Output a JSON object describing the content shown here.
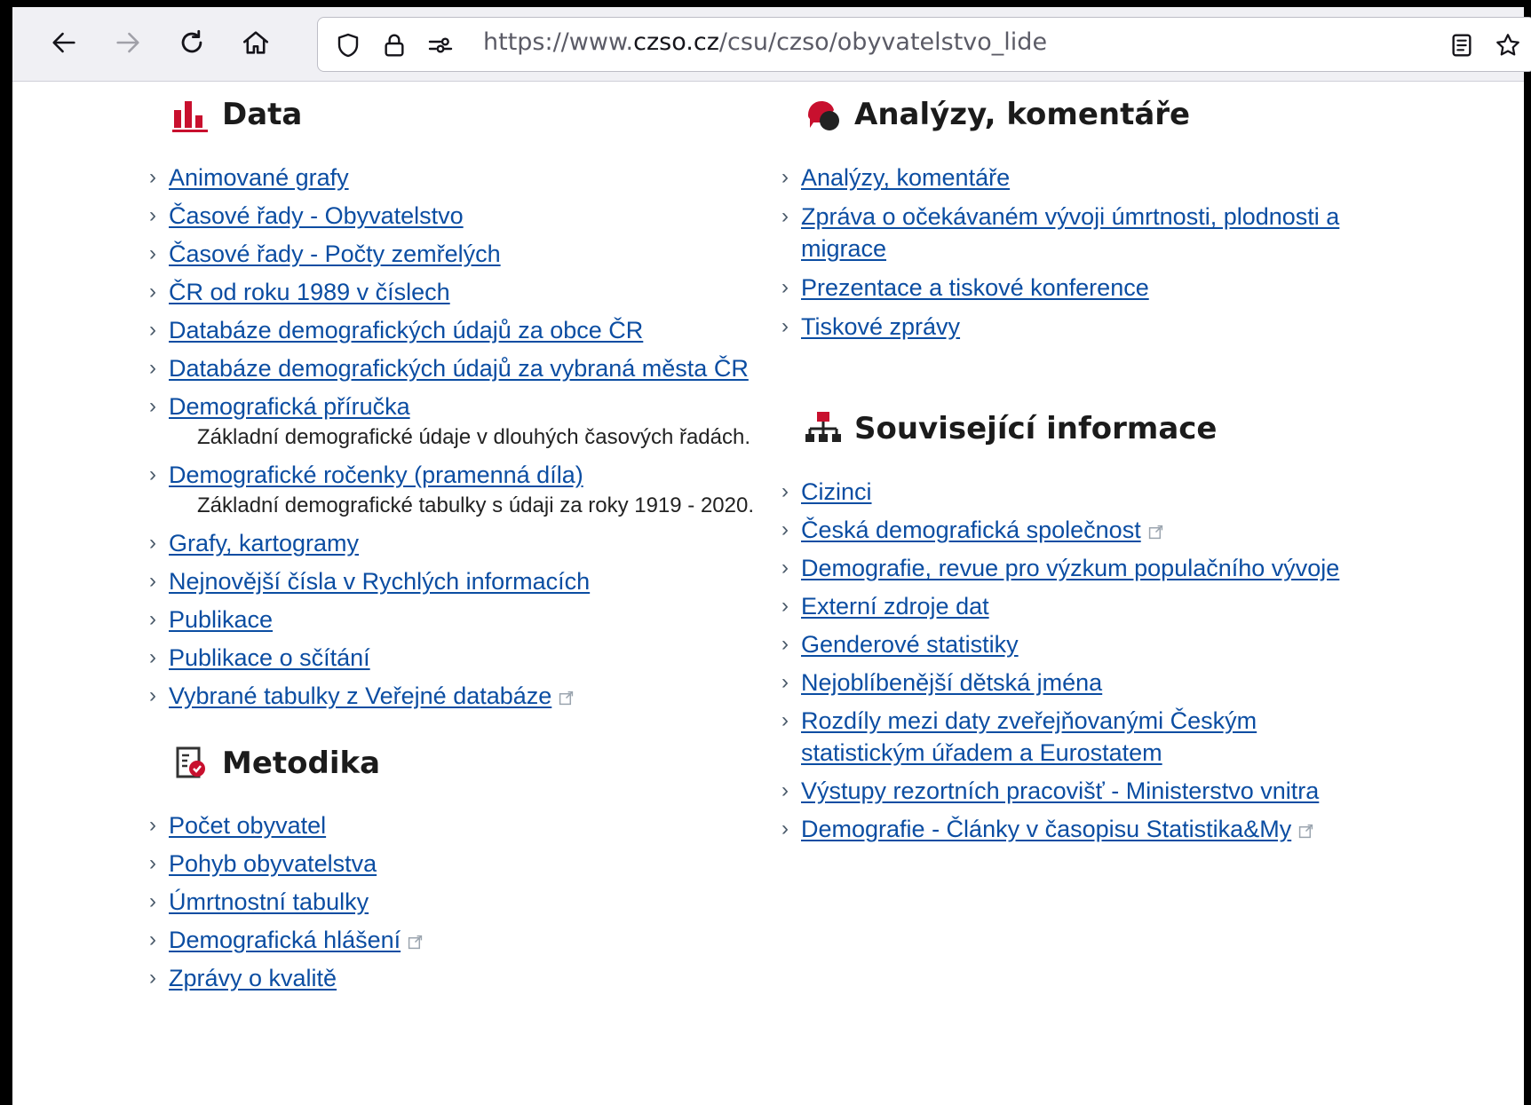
{
  "browser": {
    "url_prefix": "https://www.",
    "url_domain": "czso.cz",
    "url_path": "/csu/czso/obyvatelstvo_lide"
  },
  "data_section": {
    "title": "Data",
    "links": [
      {
        "label": "Animované grafy"
      },
      {
        "label": "Časové řady - Obyvatelstvo"
      },
      {
        "label": "Časové řady - Počty zemřelých"
      },
      {
        "label": "ČR od roku 1989 v číslech"
      },
      {
        "label": "Databáze demografických údajů za obce ČR"
      },
      {
        "label": "Databáze demografických údajů za vybraná města ČR"
      },
      {
        "label": "Demografická příručka",
        "desc": "Základní demografické údaje v dlouhých časových řadách."
      },
      {
        "label": "Demografické ročenky (pramenná díla)",
        "desc": "Základní demografické tabulky s údaji za roky 1919 - 2020."
      },
      {
        "label": "Grafy, kartogramy"
      },
      {
        "label": "Nejnovější čísla v Rychlých informacích"
      },
      {
        "label": "Publikace"
      },
      {
        "label": "Publikace o sčítání"
      },
      {
        "label": "Vybrané tabulky z Veřejné databáze",
        "external": true
      }
    ]
  },
  "metodika_section": {
    "title": "Metodika",
    "links": [
      {
        "label": "Počet obyvatel"
      },
      {
        "label": "Pohyb obyvatelstva"
      },
      {
        "label": "Úmrtnostní tabulky"
      },
      {
        "label": "Demografická hlášení",
        "external": true
      },
      {
        "label": "Zprávy o kvalitě"
      }
    ]
  },
  "analyzy_section": {
    "title": "Analýzy, komentáře",
    "links": [
      {
        "label": "Analýzy, komentáře"
      },
      {
        "label": "Zpráva o očekávaném vývoji úmrtnosti, plodnosti a migrace"
      },
      {
        "label": "Prezentace a tiskové konference"
      },
      {
        "label": "Tiskové zprávy"
      }
    ]
  },
  "souvisejici_section": {
    "title": "Související informace",
    "links": [
      {
        "label": "Cizinci"
      },
      {
        "label": "Česká demografická společnost",
        "external": true
      },
      {
        "label": "Demografie, revue pro výzkum populačního vývoje"
      },
      {
        "label": "Externí zdroje dat"
      },
      {
        "label": "Genderové statistiky"
      },
      {
        "label": "Nejoblíbenější dětská jména"
      },
      {
        "label": "Rozdíly mezi daty zveřejňovanými Českým statistickým úřadem a Eurostatem"
      },
      {
        "label": "Výstupy rezortních pracovišť - Ministerstvo vnitra"
      },
      {
        "label": "Demografie - Články v časopisu Statistika&My",
        "external": true
      }
    ]
  },
  "colors": {
    "link": "#0b4da2",
    "accent_red": "#c8102e",
    "heading": "#1b1b1b"
  },
  "icons": {
    "data": "bar-chart-icon",
    "analyzy": "speech-bubbles-icon",
    "metodika": "checklist-icon",
    "souvisejici": "sitemap-icon"
  }
}
